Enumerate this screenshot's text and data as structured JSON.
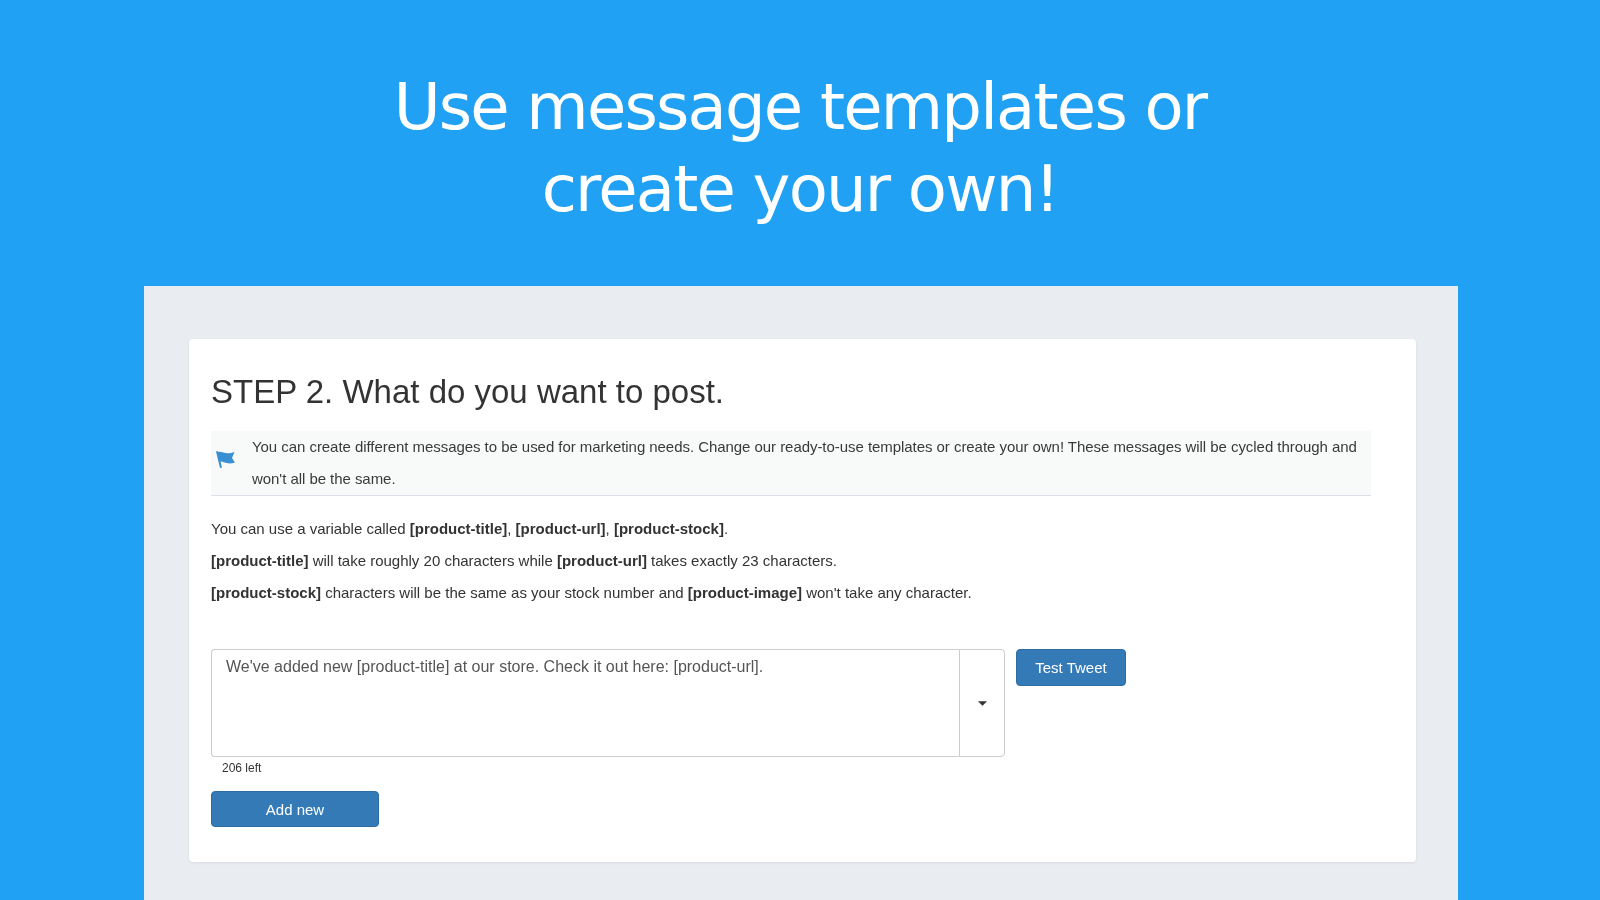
{
  "headline": [
    "Use message templates or",
    "create your own!"
  ],
  "card": {
    "title": "STEP 2. What do you want to post.",
    "notice": "You can create different messages to be used for marketing needs. Change our ready-to-use templates or create your own! These messages will be cycled through and won't all be the same.",
    "hints": [
      "You can use a variable called **[product-title]**, **[product-url]**, **[product-stock]**.",
      "**[product-title]** will take roughly 20 characters while **[product-url]** takes exactly 23 characters.",
      "**[product-stock]** characters will be the same as your stock number and **[product-image]** won't take any character."
    ],
    "message": {
      "value": "We've added new [product-title] at our store. Check it out here: [product-url].",
      "counter": "206 left"
    },
    "test_button": "Test Tweet",
    "add_button": "Add new"
  }
}
